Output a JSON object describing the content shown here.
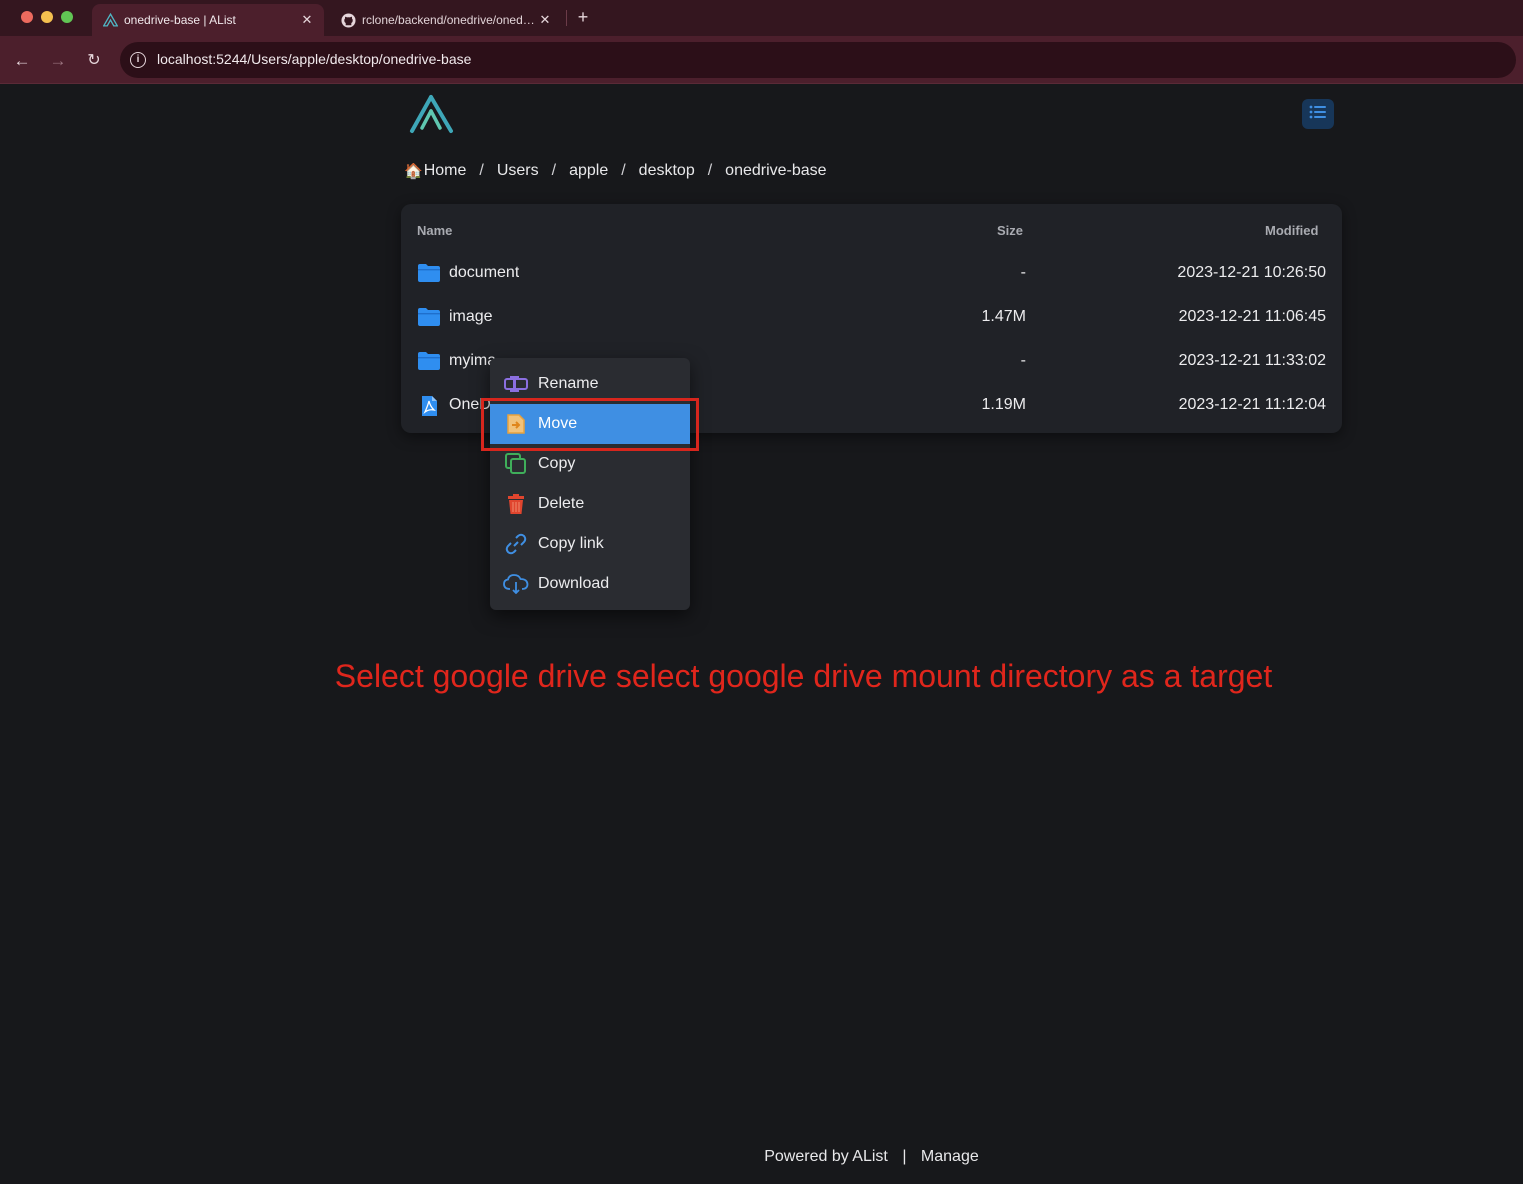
{
  "browser": {
    "tabs": [
      {
        "title": "onedrive-base | AList",
        "active": true,
        "icon": "alist-logo-icon"
      },
      {
        "title": "rclone/backend/onedrive/onedrive.go",
        "active": false,
        "icon": "github-icon"
      }
    ],
    "new_tab": "+",
    "close_glyph": "✕",
    "url": "localhost:5244/Users/apple/desktop/onedrive-base"
  },
  "breadcrumb": {
    "home_icon": "🏠",
    "items": [
      "Home",
      "Users",
      "apple",
      "desktop",
      "onedrive-base"
    ],
    "separator": "/"
  },
  "table": {
    "headers": {
      "name": "Name",
      "size": "Size",
      "modified": "Modified"
    },
    "rows": [
      {
        "name": "document",
        "size": "-",
        "modified": "2023-12-21 10:26:50",
        "icon": "folder-icon"
      },
      {
        "name": "image",
        "size": "1.47M",
        "modified": "2023-12-21 11:06:45",
        "icon": "folder-icon"
      },
      {
        "name": "myima",
        "size": "-",
        "modified": "2023-12-21 11:33:02",
        "icon": "folder-icon"
      },
      {
        "name": "OneD",
        "size": "1.19M",
        "modified": "2023-12-21 11:12:04",
        "icon": "pdf-file-icon"
      }
    ]
  },
  "context_menu": {
    "items": [
      {
        "label": "Rename",
        "icon": "rename-icon",
        "color": "#8b6fe0"
      },
      {
        "label": "Move",
        "icon": "move-icon",
        "color": "#e8a23c",
        "active": true
      },
      {
        "label": "Copy",
        "icon": "copy-icon",
        "color": "#3fae5a"
      },
      {
        "label": "Delete",
        "icon": "delete-icon",
        "color": "#e0452e"
      },
      {
        "label": "Copy link",
        "icon": "link-icon",
        "color": "#3f8fe3"
      },
      {
        "label": "Download",
        "icon": "download-icon",
        "color": "#3f8fe3"
      }
    ]
  },
  "annotation": "Select google drive select google drive mount directory as a target",
  "footer": {
    "powered": "Powered by AList",
    "separator": "|",
    "manage": "Manage"
  },
  "colors": {
    "accent": "#3f8fe3",
    "annotation": "#e0261c",
    "highlight": "#d7261d",
    "page_bg": "#17181b",
    "panel_bg": "#202227"
  }
}
